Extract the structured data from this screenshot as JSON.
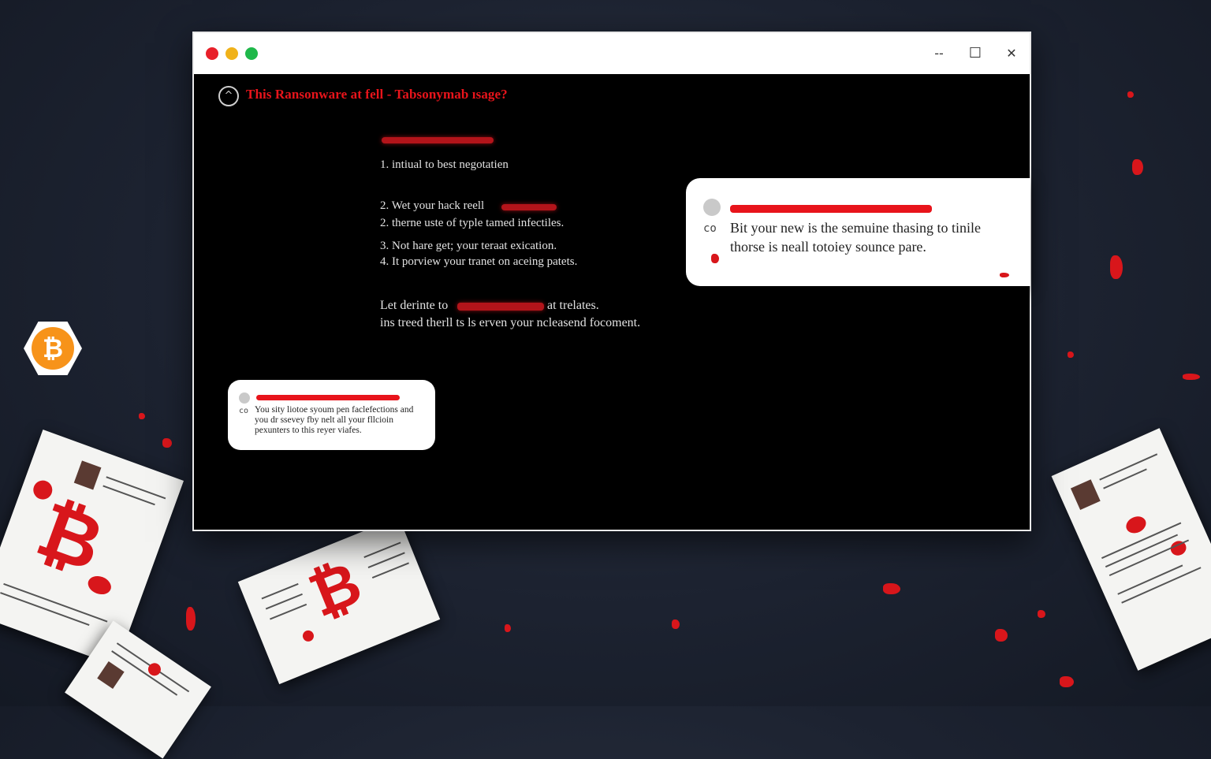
{
  "window": {
    "title": "This Ransonware at fell - Tabsonymab ısage?",
    "controls": {
      "minimize": "--",
      "maximize": "☐",
      "close": "✕"
    }
  },
  "main": {
    "lines": [
      "1. intiual to best negotatien",
      "2. Wet your hack reell",
      "2. therne uste of typle tamed infectiles.",
      "3. Not hare get; your teraat exication.",
      "4. It porview your tranet on aceing patets.",
      "Let derinte to",
      "at trelates.",
      "ins treed therll ts ls erven your ncleasend focoment."
    ]
  },
  "card_right": {
    "line1": "Bit your new is the semuine thasing to tinile",
    "line2": "thorse is neall totoiey sounce pare."
  },
  "card_left": {
    "line1": "You sity liotoe syoum pen faclefections and",
    "line2": "you dr ssevey fby nelt all your fllcioin",
    "line3": "pexunters to this reyer viafes."
  },
  "badge": {
    "symbol": "₿"
  },
  "papers": {
    "symbol": "₿"
  },
  "colors": {
    "accent_red": "#e8141b",
    "bitcoin": "#f7931a",
    "background": "#1c2230"
  }
}
